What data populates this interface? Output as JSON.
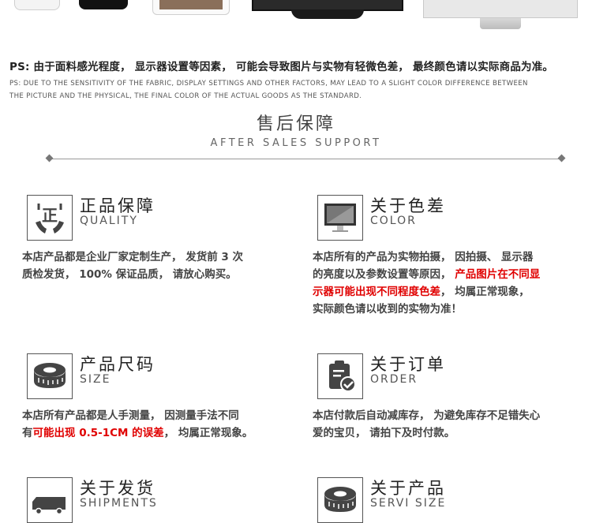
{
  "ps": {
    "cn": "PS: 由于面料感光程度，  显示器设置等因素，  可能会导致图片与实物有轻微色差，  最终颜色请以实际商品为准。",
    "en_line1": "PS: DUE TO THE SENSITIVITY OF THE FABRIC, DISPLAY SETTINGS AND OTHER FACTORS, MAY LEAD TO A SLIGHT COLOR DIFFERENCE BETWEEN",
    "en_line2": "THE PICTURE AND THE PHYSICAL, THE FINAL COLOR OF THE ACTUAL GOODS AS THE STANDARD."
  },
  "section": {
    "title_cn": "售后保障",
    "title_en": "AFTER SALES SUPPORT"
  },
  "features": [
    {
      "title": "正品保障",
      "subtitle": "QUALITY",
      "icon": "quality-hands-icon",
      "desc": [
        "本店产品都是企业厂家定制生产，  发货前 3 次",
        "质检发货，  100% 保证品质，  请放心购买。"
      ]
    },
    {
      "title": "关于色差",
      "subtitle": "COLOR",
      "icon": "monitor-icon",
      "desc_a": "本店所有的产品为实物拍摄，  因拍摄、  显示器",
      "desc_b": "的亮度以及参数设置等原因，  ",
      "desc_red1": "产品图片在不同显",
      "desc_red2": "示器可能出现不同程度色差",
      "desc_c": "，  均属正常现象，",
      "desc_d": "实际颜色请以收到的实物为准！"
    },
    {
      "title": "产品尺码",
      "subtitle": "SIZE",
      "icon": "tape-measure-icon",
      "desc_a": "本店所有产品都是人手测量，  因测量手法不同",
      "desc_b": "有",
      "desc_red": "可能出现 0.5-1CM 的误差",
      "desc_c": "，  均属正常现象。"
    },
    {
      "title": "关于订单",
      "subtitle": "ORDER",
      "icon": "clipboard-check-icon",
      "desc": [
        "本店付款后自动减库存，  为避免库存不足错失心",
        "爱的宝贝，  请拍下及时付款。"
      ]
    },
    {
      "title": "关于发货",
      "subtitle": "SHIPMENTS",
      "icon": "truck-icon"
    },
    {
      "title": "关于产品",
      "subtitle": "SERVI SIZE",
      "icon": "tape-measure-icon"
    }
  ]
}
